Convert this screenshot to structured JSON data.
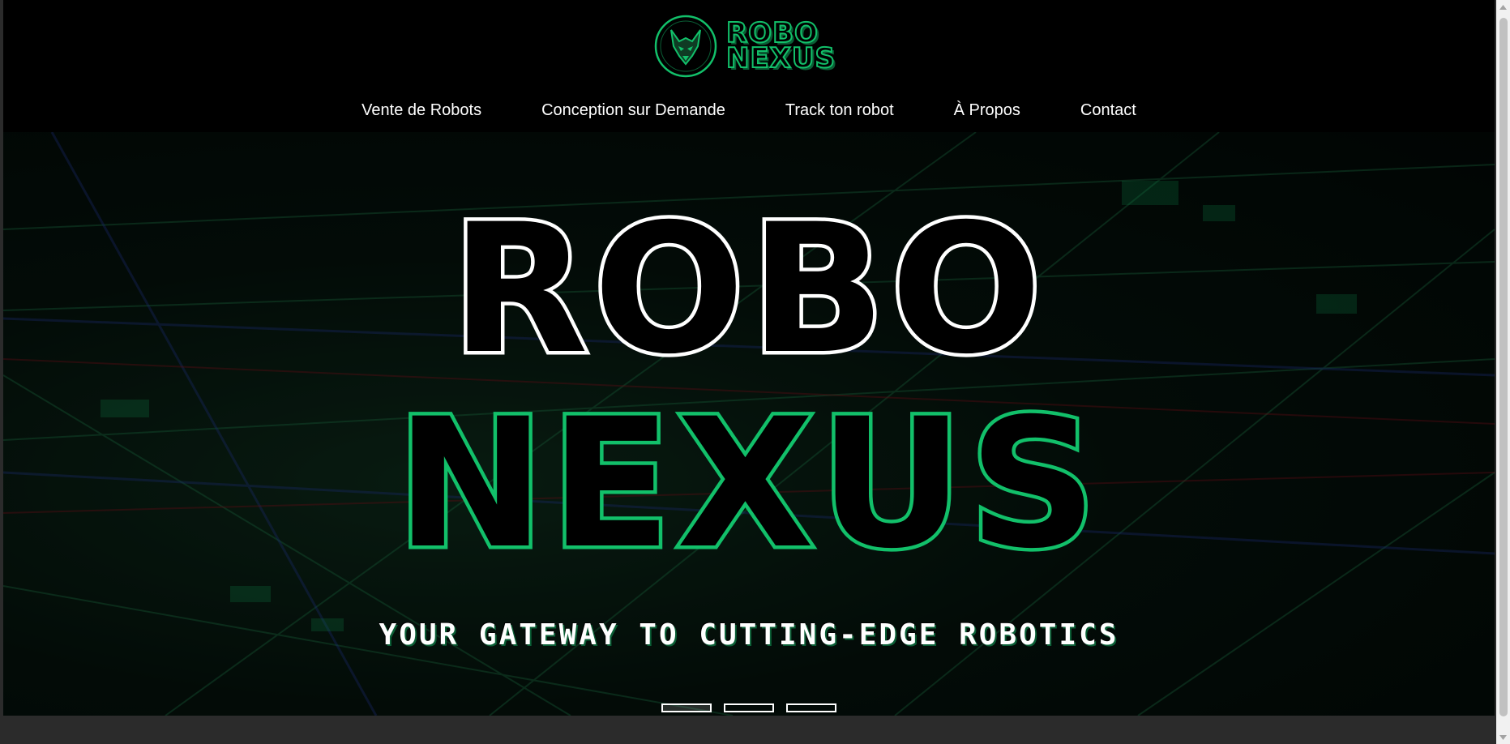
{
  "site": {
    "logo": {
      "line1": "ROBO",
      "line2": "NEXUS"
    },
    "nav": [
      {
        "label": "Vente de Robots"
      },
      {
        "label": "Conception sur Demande"
      },
      {
        "label": "Track ton robot"
      },
      {
        "label": "À Propos"
      },
      {
        "label": "Contact"
      }
    ]
  },
  "hero": {
    "title_line1": "ROBO",
    "title_line2": "NEXUS",
    "tagline": "YOUR GATEWAY TO CUTTING-EDGE ROBOTICS",
    "slides": 3,
    "active_slide": 1
  },
  "colors": {
    "accent": "#12c06a",
    "accent_dark": "#0a5e35",
    "header_bg": "#000000",
    "footer_bg": "#2b2b2b"
  },
  "icons": {
    "logo": "wolf-emblem-icon",
    "scroll_up": "scroll-up-arrow-icon",
    "scroll_down": "scroll-down-arrow-icon"
  }
}
